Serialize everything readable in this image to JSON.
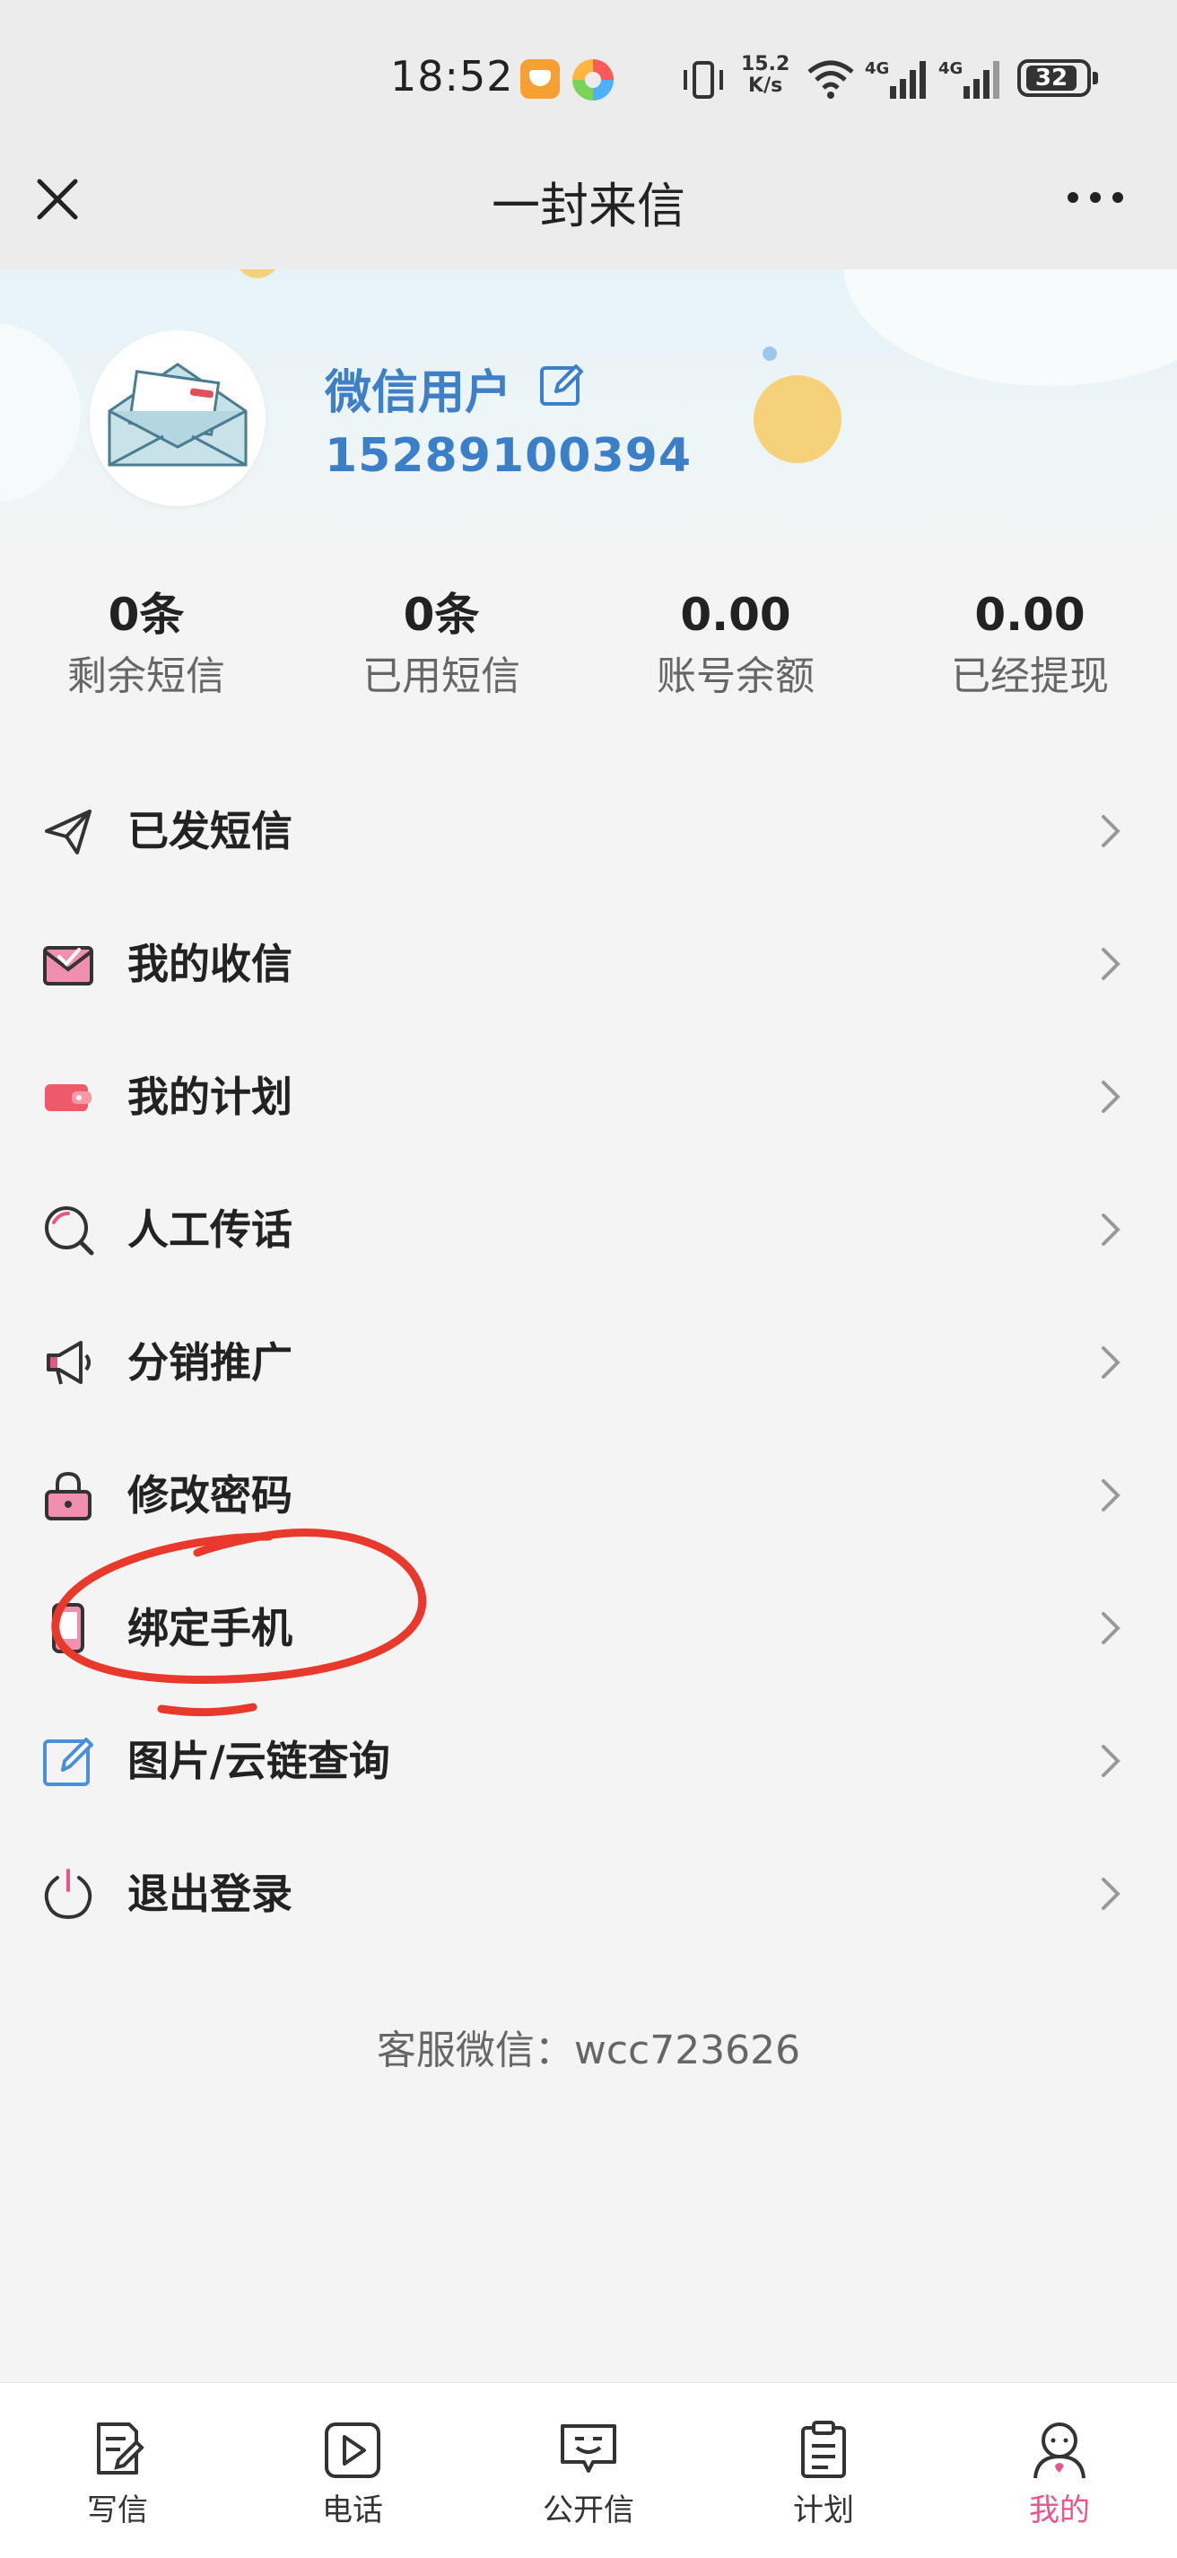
{
  "status_bar": {
    "time": "18:52",
    "speed_value": "15.2",
    "speed_unit": "K/s",
    "network_1": "4G",
    "network_2": "4G",
    "battery": "32"
  },
  "titlebar": {
    "title": "一封来信",
    "close_icon": "close-icon",
    "more_icon": "more-icon"
  },
  "profile": {
    "username": "微信用户",
    "phone": "15289100394"
  },
  "stats": [
    {
      "value": "0条",
      "label": "剩余短信"
    },
    {
      "value": "0条",
      "label": "已用短信"
    },
    {
      "value": "0.00",
      "label": "账号余额"
    },
    {
      "value": "0.00",
      "label": "已经提现"
    }
  ],
  "menu": [
    {
      "label": "已发短信",
      "icon": "send-icon"
    },
    {
      "label": "我的收信",
      "icon": "inbox-icon"
    },
    {
      "label": "我的计划",
      "icon": "plan-icon"
    },
    {
      "label": "人工传话",
      "icon": "search-chat-icon"
    },
    {
      "label": "分销推广",
      "icon": "megaphone-icon"
    },
    {
      "label": "修改密码",
      "icon": "lock-icon"
    },
    {
      "label": "绑定手机",
      "icon": "phone-icon"
    },
    {
      "label": "图片/云链查询",
      "icon": "edit-icon"
    },
    {
      "label": "退出登录",
      "icon": "power-icon"
    }
  ],
  "service_text": "客服微信：wcc723626",
  "colors": {
    "accent_blue": "#3f7fc8",
    "active_pink": "#e8558a",
    "annotation_red": "#e8392c"
  },
  "bottom_nav": [
    {
      "label": "写信",
      "icon": "write-icon",
      "active": false
    },
    {
      "label": "电话",
      "icon": "video-call-icon",
      "active": false
    },
    {
      "label": "公开信",
      "icon": "public-letter-icon",
      "active": false
    },
    {
      "label": "计划",
      "icon": "clipboard-icon",
      "active": false
    },
    {
      "label": "我的",
      "icon": "profile-icon",
      "active": true
    }
  ]
}
